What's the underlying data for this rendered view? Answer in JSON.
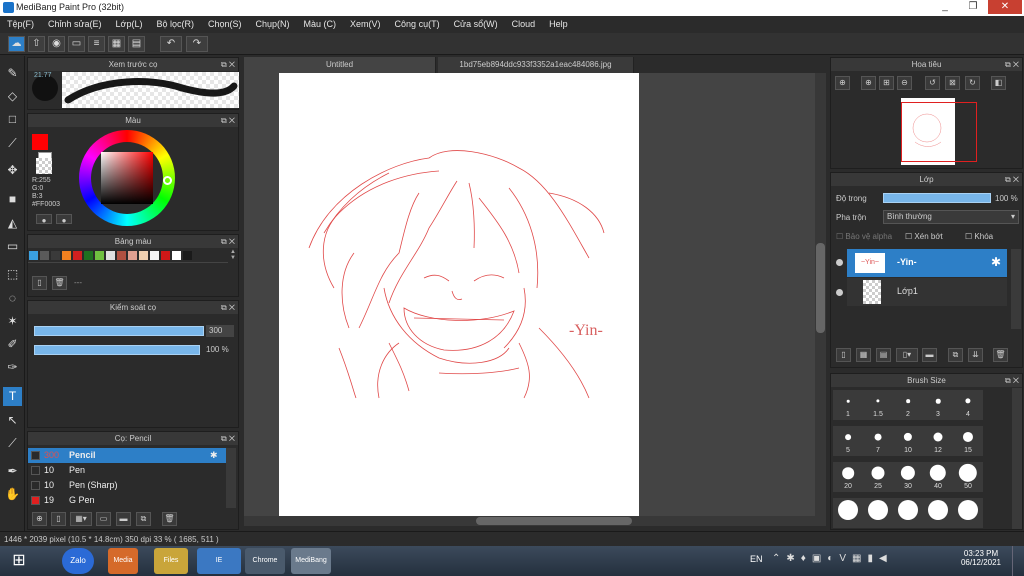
{
  "window": {
    "title": "MediBang Paint Pro (32bit)",
    "minimize": "_",
    "restore": "❐",
    "close": "✕"
  },
  "menu": [
    "Tệp(F)",
    "Chỉnh sửa(E)",
    "Lớp(L)",
    "Bộ lọc(R)",
    "Chọn(S)",
    "Chụp(N)",
    "Màu (C)",
    "Xem(V)",
    "Công cụ(T)",
    "Cửa sổ(W)",
    "Cloud",
    "Help"
  ],
  "toolbar_icons": [
    "cloud-icon",
    "share-icon",
    "comment-icon",
    "document-icon",
    "page-icon",
    "grid-icon",
    "layout-icon",
    "undo-icon",
    "redo-icon"
  ],
  "brush_preview": {
    "title": "Xem trước cọ",
    "size_label": "21.77"
  },
  "color_panel": {
    "title": "Màu",
    "r": "R:255",
    "g": "G:0",
    "b": "B:3",
    "hex": "#FF0003",
    "primary": "#ff0003",
    "secondary": "#ffffff"
  },
  "palette": {
    "title": "Bảng màu",
    "placeholder": "---",
    "colors": [
      "#3aa0e0",
      "#5a5a5a",
      "#3a3a3a",
      "#f08020",
      "#d02020",
      "#207020",
      "#70c040",
      "#e0e0e0",
      "#b05040",
      "#e0a090",
      "#f0d0b0",
      "#f5f5f5",
      "#d01818",
      "#ffffff",
      "#1a1a1a"
    ]
  },
  "brush_control": {
    "title": "Kiểm soát cọ",
    "size_value": "300",
    "opacity_value": "100 %"
  },
  "brush_list": {
    "title": "Cọ: Pencil",
    "items": [
      {
        "size": "300",
        "name": "Pencil",
        "selected": true,
        "color": "#2a2a2a"
      },
      {
        "size": "10",
        "name": "Pen",
        "selected": false,
        "color": "#2a2a2a"
      },
      {
        "size": "10",
        "name": "Pen (Sharp)",
        "selected": false,
        "color": "#2a2a2a"
      },
      {
        "size": "19",
        "name": "G Pen",
        "selected": false,
        "color": "#e02020"
      }
    ]
  },
  "tabs": {
    "active": "Untitled",
    "other": "1bd75eb894ddc933f3352a1eac484086.jpg"
  },
  "canvas": {
    "signature": "-Yin-"
  },
  "navigator": {
    "title": "Hoa tiêu"
  },
  "layer_panel": {
    "title": "Lớp",
    "opacity_label": "Độ trong",
    "opacity_value": "100 %",
    "opacity_fraction": 1.0,
    "blend_label": "Pha trộn",
    "blend_value": "Bình thường",
    "protect_alpha": "Bảo vệ alpha",
    "clipping": "Xén bớt",
    "lock": "Khóa",
    "layers": [
      {
        "name": "-Yin-",
        "thumb": "~Yin~",
        "selected": true
      },
      {
        "name": "Lớp1",
        "thumb": "",
        "selected": false
      }
    ]
  },
  "brush_size": {
    "title": "Brush Size",
    "sizes": [
      "1",
      "1.5",
      "2",
      "3",
      "4",
      "5",
      "7",
      "10",
      "12",
      "15",
      "20",
      "25",
      "30",
      "40",
      "50"
    ]
  },
  "status": {
    "text": "1446 * 2039 pixel  (10.5 * 14.8cm)  350 dpi  33 %  ( 1685, 511 )"
  },
  "taskbar": {
    "lang": "EN",
    "time": "03:23 PM",
    "date": "06/12/2021",
    "apps": [
      "Zalo",
      "Media",
      "Files",
      "IE",
      "Chrome",
      "MediBang"
    ]
  }
}
